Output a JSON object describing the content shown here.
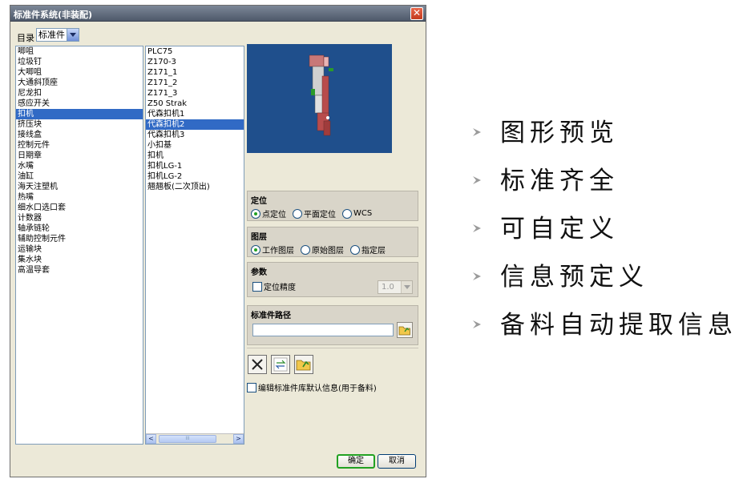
{
  "window": {
    "title": "标准件系统(非装配)",
    "close_label": "✕"
  },
  "catalog": {
    "label": "目录",
    "value": "标准件"
  },
  "left_list": {
    "items": [
      "唧咀",
      "垃圾钉",
      "大唧咀",
      "大通斜顶座",
      "尼龙扣",
      "感应开关",
      "扣机",
      "挤压块",
      "接线盒",
      "控制元件",
      "日期章",
      "水嘴",
      "油缸",
      "海天注塑机",
      "热嘴",
      "细水口选口套",
      "计数器",
      "轴承链轮",
      "辅助控制元件",
      "运输块",
      "集水块",
      "高温导套"
    ],
    "selected_index": 6
  },
  "mid_list": {
    "items": [
      "PLC75",
      "Z170-3",
      "Z171_1",
      "Z171_2",
      "Z171_3",
      "Z50 Strak",
      "代森扣机1",
      "代森扣机2",
      "代森扣机3",
      "小扣基",
      "扣机",
      "扣机LG-1",
      "扣机LG-2",
      "翘翘板(二次顶出)"
    ],
    "selected_index": 7,
    "scroll_left": "<",
    "scroll_right": ">",
    "scroll_thumb": "III"
  },
  "positioning": {
    "title": "定位",
    "options": [
      "点定位",
      "平面定位",
      "WCS"
    ],
    "selected_index": 0
  },
  "layer": {
    "title": "图层",
    "options": [
      "工作图层",
      "原始图层",
      "指定层"
    ],
    "selected_index": 0
  },
  "params": {
    "title": "参数",
    "precision_label": "定位精度",
    "precision_value": "1.0"
  },
  "path": {
    "title": "标准件路径",
    "value": ""
  },
  "edit_checkbox": {
    "label": "编辑标准件库默认信息(用于备料)"
  },
  "buttons": {
    "ok": "确定",
    "cancel": "取消"
  },
  "bullets": [
    "图形预览",
    "标准齐全",
    "可自定义",
    "信息预定义",
    "备料自动提取信息"
  ],
  "colors": {
    "selection": "#316ac5",
    "preview_bg": "#1f4f8c",
    "ok_border": "#21a121"
  }
}
